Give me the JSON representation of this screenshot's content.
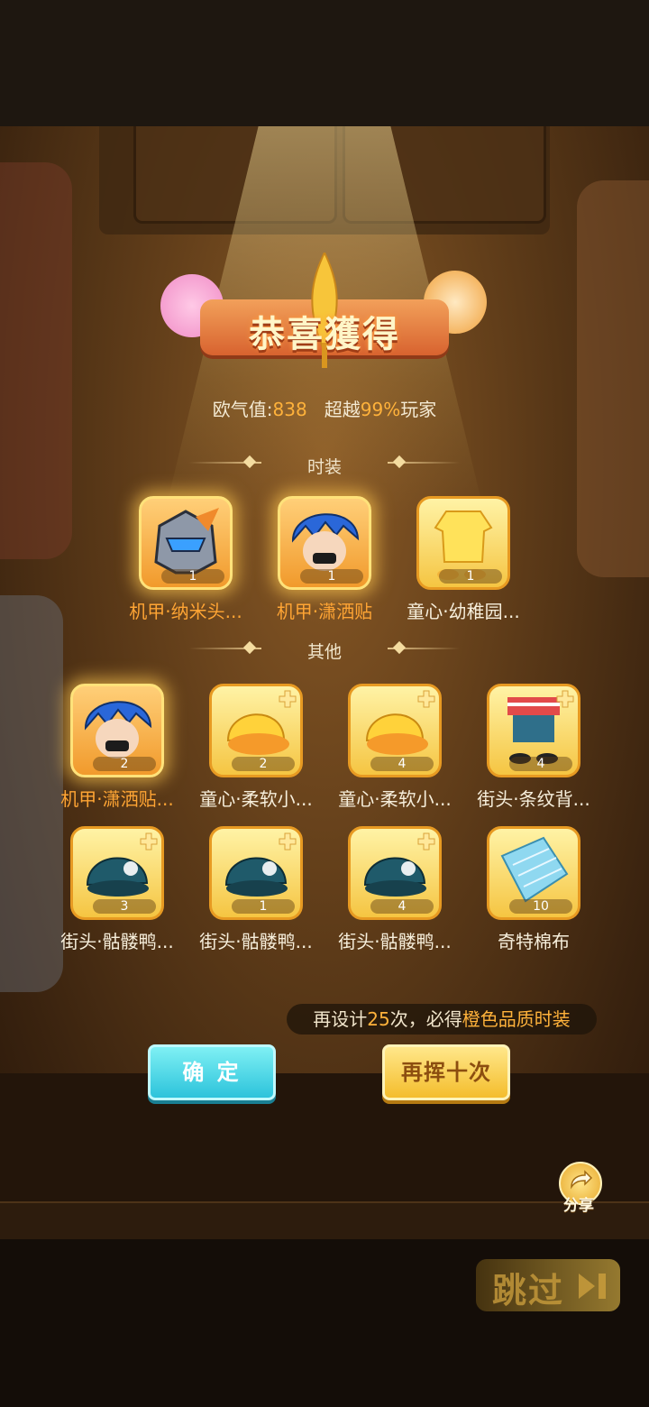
{
  "banner": {
    "title": "恭喜獲得"
  },
  "luck": {
    "label": "欧气值:",
    "value": "838",
    "mid": "超越",
    "percent": "99%",
    "suffix": "玩家"
  },
  "sections": {
    "fashion": "时装",
    "other": "其他"
  },
  "fashion_items": [
    {
      "name": "机甲·纳米头...",
      "count": "1",
      "quality": "orange",
      "icon": "mecha-helmet-icon"
    },
    {
      "name": "机甲·潇洒贴",
      "count": "1",
      "quality": "orange",
      "icon": "blue-hair-character-icon"
    },
    {
      "name": "童心·幼稚园...",
      "count": "1",
      "quality": "yellow",
      "icon": "yellow-outfit-icon"
    }
  ],
  "other_items": [
    {
      "name": "机甲·潇洒贴...",
      "count": "2",
      "quality": "orange",
      "icon": "blue-hair-character-icon"
    },
    {
      "name": "童心·柔软小...",
      "count": "2",
      "quality": "yellow",
      "icon": "yellow-hat-icon"
    },
    {
      "name": "童心·柔软小...",
      "count": "4",
      "quality": "yellow",
      "icon": "yellow-hat-icon"
    },
    {
      "name": "街头·条纹背...",
      "count": "4",
      "quality": "yellow",
      "icon": "striped-overalls-icon"
    },
    {
      "name": "街头·骷髅鸭...",
      "count": "3",
      "quality": "yellow",
      "icon": "skull-cap-icon"
    },
    {
      "name": "街头·骷髅鸭...",
      "count": "1",
      "quality": "yellow",
      "icon": "skull-cap-icon"
    },
    {
      "name": "街头·骷髅鸭...",
      "count": "4",
      "quality": "yellow",
      "icon": "skull-cap-icon"
    },
    {
      "name": "奇特棉布",
      "count": "10",
      "quality": "yellow",
      "icon": "cotton-cloth-icon"
    }
  ],
  "notice": {
    "prefix": "再设计",
    "count": "25",
    "mid": "次，必得",
    "reward": "橙色品质时装"
  },
  "buttons": {
    "confirm": "确 定",
    "again": "再挥十次"
  },
  "share": {
    "label": "分享"
  },
  "skip": {
    "label": "跳过"
  },
  "colors": {
    "orange_quality": "#ffa534",
    "highlight": "#ffb23b",
    "confirm_bg": "#2cc3db",
    "again_bg": "#f4bd2c"
  }
}
